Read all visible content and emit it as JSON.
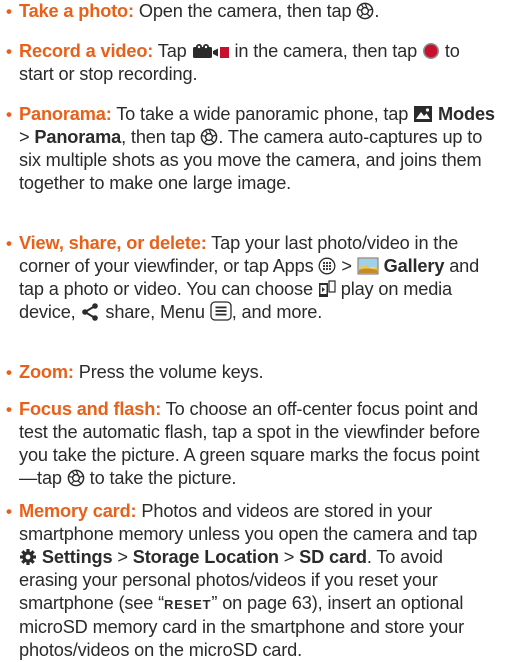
{
  "tips": [
    {
      "lead": "Take a photo:",
      "p1": " Open the camera, then tap ",
      "p2": "."
    },
    {
      "lead": "Record a video:",
      "p1": " Tap ",
      "p2": " in the camera, then tap ",
      "p3": " to start or stop recording."
    },
    {
      "lead": "Panorama:",
      "p1": " To take a wide panoramic phone, tap ",
      "modes": "Modes",
      "sep1": " > ",
      "panorama": "Panorama",
      "p2": ", then tap ",
      "p3": ". The camera auto-captures up to six multiple shots as you move the camera, and joins them together to make one large image."
    },
    {
      "lead": "View, share, or delete:",
      "p1": " Tap your last photo/video in the corner of your viewfinder, or tap Apps ",
      "sep1": " > ",
      "gallery": "Gallery",
      "p2": " and tap a photo or video. You can choose ",
      "p3": " play on media device, ",
      "p4": " share, Menu ",
      "p5": ", and more."
    },
    {
      "lead": "Zoom:",
      "p1": " Press the volume keys."
    },
    {
      "lead": "Focus and flash:",
      "p1": " To choose an off-center focus point and test the automatic flash, tap a spot in the viewfinder before you take the picture. A green square marks the focus point—tap ",
      "p2": " to take the picture."
    },
    {
      "lead": "Memory card:",
      "p1": " Photos and videos are stored in your smartphone memory unless you open the camera and tap ",
      "settings": "Settings",
      "sep1": " > ",
      "storage": "Storage Location",
      "sep2": " > ",
      "sdcard": "SD card",
      "p2": ". To avoid erasing your personal photos/videos if you reset your smartphone (see “",
      "reset": "RESET",
      "p3": "” on page 63), insert an optional microSD memory card in the smartphone and store your photos/videos on the microSD card."
    }
  ],
  "bullet": "•",
  "icons": {
    "shutter": "camera-shutter-icon",
    "video_mode": "video-camera-icon",
    "record": "record-dot-icon",
    "modes": "modes-picture-icon",
    "apps": "apps-grid-icon",
    "gallery": "gallery-landscape-icon",
    "media_device": "play-on-media-device-icon",
    "share": "share-icon",
    "menu": "menu-lines-icon",
    "settings": "settings-gear-icon"
  },
  "colors": {
    "accent": "#e8611a",
    "text": "#2b2b2b",
    "record_red": "#c8102e"
  }
}
